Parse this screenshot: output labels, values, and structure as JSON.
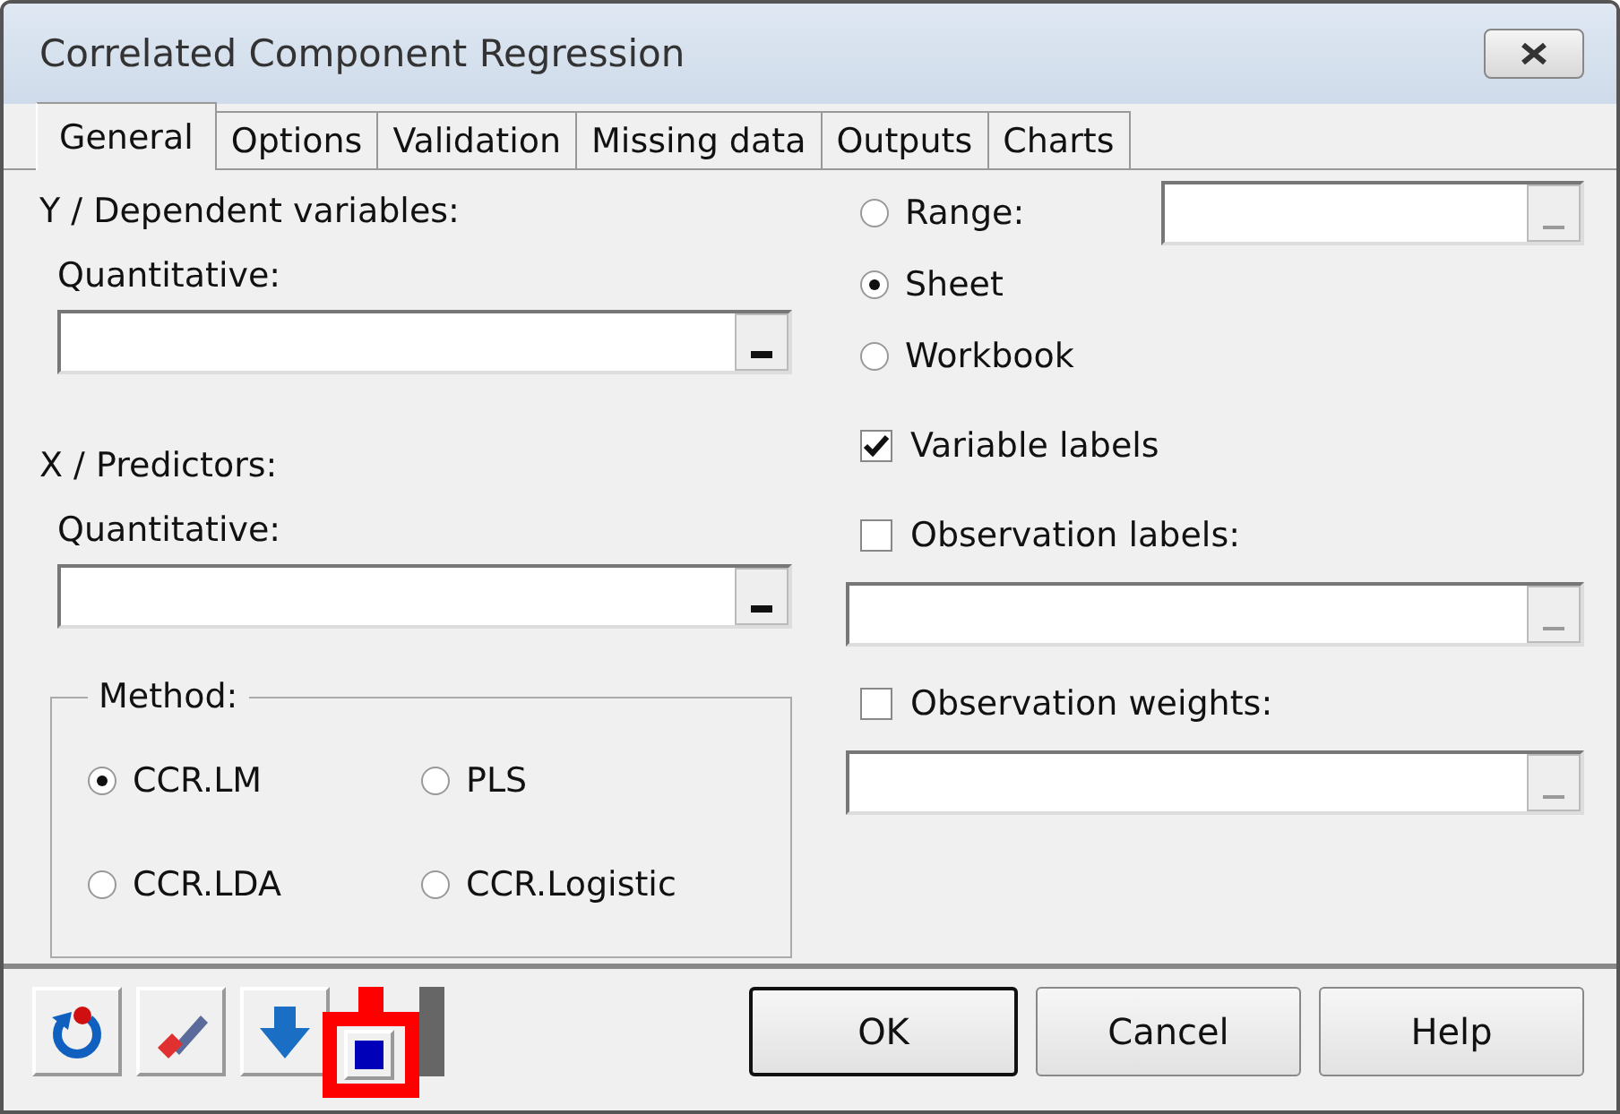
{
  "window": {
    "title": "Correlated Component Regression"
  },
  "tabs": [
    {
      "label": "General",
      "selected": true
    },
    {
      "label": "Options",
      "selected": false
    },
    {
      "label": "Validation",
      "selected": false
    },
    {
      "label": "Missing data",
      "selected": false
    },
    {
      "label": "Outputs",
      "selected": false
    },
    {
      "label": "Charts",
      "selected": false
    }
  ],
  "dependent": {
    "heading": "Y / Dependent variables:",
    "sublabel": "Quantitative:"
  },
  "predictors": {
    "heading": "X / Predictors:",
    "sublabel": "Quantitative:"
  },
  "method": {
    "legend": "Method:",
    "options": [
      {
        "label": "CCR.LM",
        "selected": true
      },
      {
        "label": "PLS",
        "selected": false
      },
      {
        "label": "CCR.LDA",
        "selected": false
      },
      {
        "label": "CCR.Logistic",
        "selected": false
      }
    ]
  },
  "source": [
    {
      "label": "Range:",
      "selected": false
    },
    {
      "label": "Sheet",
      "selected": true
    },
    {
      "label": "Workbook",
      "selected": false
    }
  ],
  "checkboxes": [
    {
      "label": "Variable labels",
      "checked": true,
      "field": false
    },
    {
      "label": "Observation labels:",
      "checked": false,
      "field": true
    },
    {
      "label": "Observation weights:",
      "checked": false,
      "field": true
    }
  ],
  "buttons": [
    {
      "label": "OK",
      "default": true
    },
    {
      "label": "Cancel",
      "default": false
    },
    {
      "label": "Help",
      "default": false
    }
  ]
}
